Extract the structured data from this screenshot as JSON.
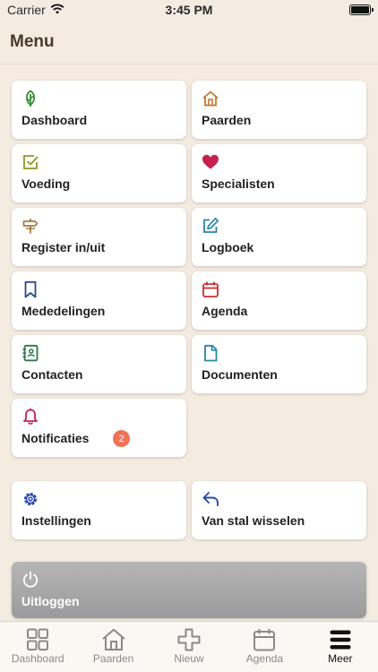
{
  "status_bar": {
    "carrier": "Carrier",
    "time": "3:45 PM"
  },
  "header": {
    "title": "Menu"
  },
  "menu_items": [
    {
      "label": "Dashboard",
      "icon": "leaf-icon",
      "color": "#3a8a3a"
    },
    {
      "label": "Paarden",
      "icon": "house-icon",
      "color": "#c8782e"
    },
    {
      "label": "Voeding",
      "icon": "checkbox-icon",
      "color": "#8a9a2a"
    },
    {
      "label": "Specialisten",
      "icon": "heart-icon",
      "color": "#c8204e"
    },
    {
      "label": "Register in/uit",
      "icon": "signpost-icon",
      "color": "#a07a4a"
    },
    {
      "label": "Logboek",
      "icon": "edit-icon",
      "color": "#2a86a8"
    },
    {
      "label": "Mededelingen",
      "icon": "bookmark-icon",
      "color": "#2a4a8a"
    },
    {
      "label": "Agenda",
      "icon": "calendar-icon",
      "color": "#c83030"
    },
    {
      "label": "Contacten",
      "icon": "address-book-icon",
      "color": "#2a7a4a"
    },
    {
      "label": "Documenten",
      "icon": "document-icon",
      "color": "#2a86a8"
    },
    {
      "label": "Notificaties",
      "icon": "bell-icon",
      "color": "#c8204e",
      "badge": "2"
    }
  ],
  "settings_items": [
    {
      "label": "Instellingen",
      "icon": "gear-icon",
      "color": "#2a4aa8"
    },
    {
      "label": "Van stal wisselen",
      "icon": "undo-arrow-icon",
      "color": "#2a4aa8"
    }
  ],
  "logout": {
    "label": "Uitloggen",
    "icon": "power-icon"
  },
  "tab_bar": [
    {
      "label": "Dashboard",
      "icon": "grid-icon",
      "active": false
    },
    {
      "label": "Paarden",
      "icon": "house-icon",
      "active": false
    },
    {
      "label": "Nieuw",
      "icon": "plus-icon",
      "active": false
    },
    {
      "label": "Agenda",
      "icon": "calendar-icon",
      "active": false
    },
    {
      "label": "Meer",
      "icon": "menu-icon",
      "active": true
    }
  ]
}
